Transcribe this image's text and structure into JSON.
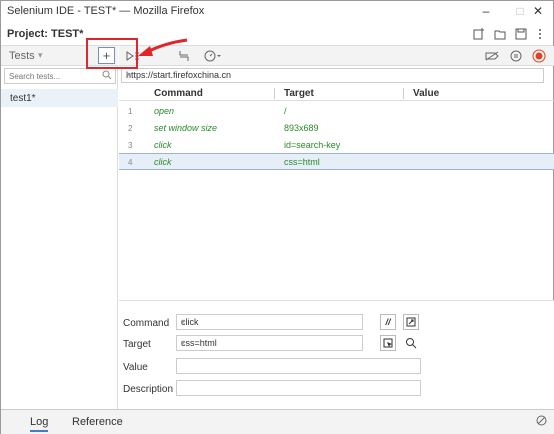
{
  "window": {
    "title": "Selenium IDE - TEST* — Mozilla Firefox",
    "min": "–",
    "max": "□",
    "close": "✕"
  },
  "project": {
    "label": "Project:  TEST*"
  },
  "tests": {
    "label": "Tests",
    "dropdown": "▾",
    "add": "+",
    "search_placeholder": "Search tests...",
    "items": [
      "test1*"
    ]
  },
  "url": {
    "value": "https://start.firefoxchina.cn",
    "dropdown": "▾"
  },
  "table": {
    "headers": {
      "command": "Command",
      "target": "Target",
      "value": "Value"
    },
    "rows": [
      {
        "num": "1",
        "command": "open",
        "target": "/",
        "value": ""
      },
      {
        "num": "2",
        "command": "set window size",
        "target": "893x689",
        "value": ""
      },
      {
        "num": "3",
        "command": "click",
        "target": "id=search-key",
        "value": ""
      },
      {
        "num": "4",
        "command": "click",
        "target": "css=html",
        "value": ""
      }
    ]
  },
  "editor": {
    "command_label": "Command",
    "command_value": "click",
    "target_label": "Target",
    "target_value": "css=html",
    "value_label": "Value",
    "value_value": "",
    "description_label": "Description",
    "description_value": "",
    "comment_btn": "//"
  },
  "bottom": {
    "log": "Log",
    "reference": "Reference"
  },
  "colors": {
    "highlight": "#e0262b",
    "command_text": "#2a8a2a",
    "selected_row": "#e6eef8"
  }
}
